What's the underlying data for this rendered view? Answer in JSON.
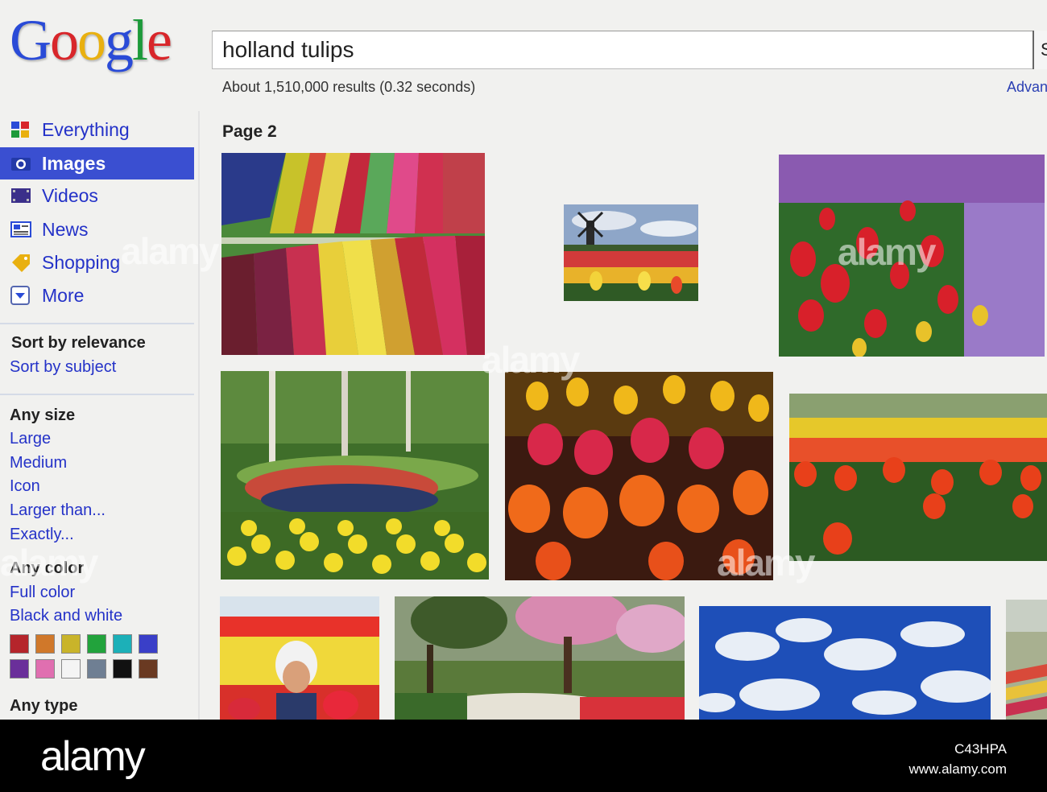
{
  "logo": {
    "text": "Google"
  },
  "search": {
    "query": "holland tulips",
    "button_edge_glyph": "S"
  },
  "results": {
    "stats": "About 1,510,000 results (0.32 seconds)",
    "advanced_link": "Advan",
    "page_label": "Page 2"
  },
  "sidebar": {
    "nav": [
      {
        "label": "Everything",
        "icon": "everything-icon",
        "selected": false
      },
      {
        "label": "Images",
        "icon": "camera-icon",
        "selected": true
      },
      {
        "label": "Videos",
        "icon": "film-icon",
        "selected": false
      },
      {
        "label": "News",
        "icon": "newspaper-icon",
        "selected": false
      },
      {
        "label": "Shopping",
        "icon": "tag-icon",
        "selected": false
      },
      {
        "label": "More",
        "icon": "chevron-down-icon",
        "selected": false
      }
    ],
    "sort": {
      "active": "Sort by relevance",
      "alternative": "Sort by subject"
    },
    "size": {
      "heading": "Any size",
      "options": [
        "Large",
        "Medium",
        "Icon",
        "Larger than...",
        "Exactly..."
      ]
    },
    "color": {
      "heading": "Any color",
      "options": [
        "Full color",
        "Black and white"
      ],
      "swatches": [
        "#b5252b",
        "#d0782a",
        "#c9b42a",
        "#22a33c",
        "#1cb0b8",
        "#3a3fc8",
        "#6a2f9a",
        "#e06fb0",
        "#f4f4f4",
        "#6f7f93",
        "#111111",
        "#6a3a22"
      ]
    },
    "type": {
      "heading": "Any type"
    }
  },
  "footer": {
    "brand": "alamy",
    "image_id": "C43HPA",
    "site": "www.alamy.com"
  },
  "watermark": "alamy"
}
